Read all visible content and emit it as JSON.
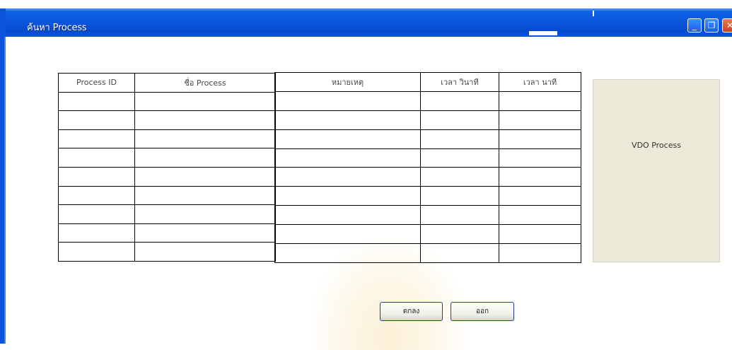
{
  "window": {
    "title": "ค้นหา Process",
    "controls": {
      "minimize": "_",
      "maximize": "❐",
      "close": "✕"
    }
  },
  "table": {
    "headers": [
      "Process ID",
      "ชื่อ Process",
      "หมายเหตุ",
      "เวลา วินาที",
      "เวลา นาที"
    ],
    "row_count": 9
  },
  "video_panel": {
    "label": "VDO Process"
  },
  "buttons": {
    "ok_label": "ตกลง",
    "cancel_label": "ออก"
  },
  "colors": {
    "titlebar": "#0a55dc",
    "panel": "#ece9d8"
  }
}
